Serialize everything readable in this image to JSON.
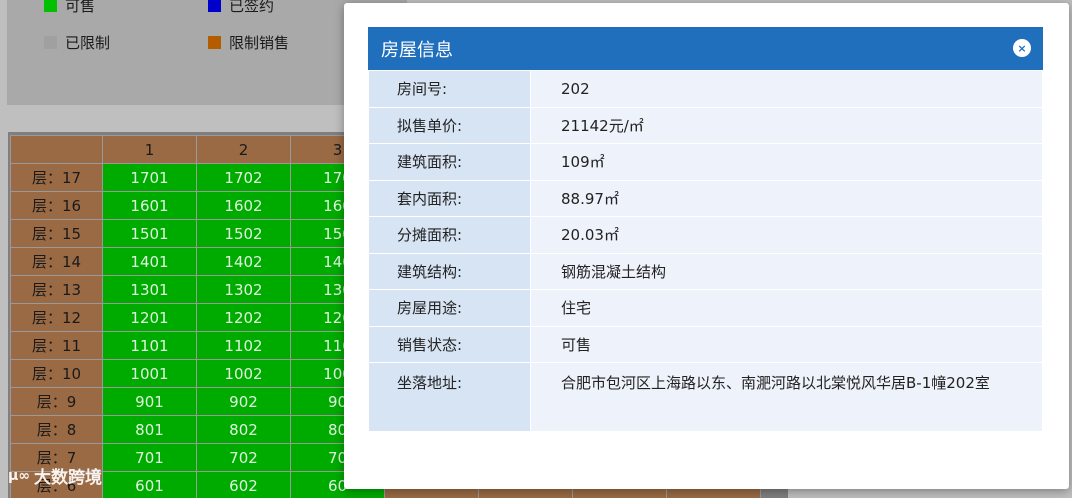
{
  "legend": {
    "items": [
      {
        "label": "可售",
        "color": "#00c000"
      },
      {
        "label": "已签约",
        "color": "#0000cc"
      },
      {
        "label": "已限制",
        "color": "#a0a0a0"
      },
      {
        "label": "限制销售",
        "color": "#b35c00"
      }
    ]
  },
  "grid": {
    "columns": [
      "1",
      "2",
      "3"
    ],
    "rows": [
      {
        "floor": "层：17",
        "units": [
          "1701",
          "1702",
          "170"
        ]
      },
      {
        "floor": "层：16",
        "units": [
          "1601",
          "1602",
          "160"
        ]
      },
      {
        "floor": "层：15",
        "units": [
          "1501",
          "1502",
          "150"
        ]
      },
      {
        "floor": "层：14",
        "units": [
          "1401",
          "1402",
          "140"
        ]
      },
      {
        "floor": "层：13",
        "units": [
          "1301",
          "1302",
          "130"
        ]
      },
      {
        "floor": "层：12",
        "units": [
          "1201",
          "1202",
          "120"
        ]
      },
      {
        "floor": "层：11",
        "units": [
          "1101",
          "1102",
          "110"
        ]
      },
      {
        "floor": "层：10",
        "units": [
          "1001",
          "1002",
          "100"
        ]
      },
      {
        "floor": "层：9",
        "units": [
          "901",
          "902",
          "90"
        ]
      },
      {
        "floor": "层：8",
        "units": [
          "801",
          "802",
          "80"
        ]
      },
      {
        "floor": "层：7",
        "units": [
          "701",
          "702",
          "70"
        ]
      },
      {
        "floor": "层：6",
        "units": [
          "601",
          "602",
          "60"
        ]
      }
    ]
  },
  "modal": {
    "title": "房屋信息",
    "close_label": "×",
    "fields": [
      {
        "key": "房间号:",
        "value": "202"
      },
      {
        "key": "拟售单价:",
        "value": "21142元/㎡"
      },
      {
        "key": "建筑面积:",
        "value": "109㎡"
      },
      {
        "key": "套内面积:",
        "value": "88.97㎡"
      },
      {
        "key": "分摊面积:",
        "value": "20.03㎡"
      },
      {
        "key": "建筑结构:",
        "value": "钢筋混凝土结构"
      },
      {
        "key": "房屋用途:",
        "value": "住宅"
      },
      {
        "key": "销售状态:",
        "value": "可售"
      },
      {
        "key": "坐落地址:",
        "value": "合肥市包河区上海路以东、南淝河路以北棠悦风华居B-1幢202室"
      }
    ]
  },
  "watermark": {
    "logo": "μ∞",
    "text": "大数跨境"
  }
}
